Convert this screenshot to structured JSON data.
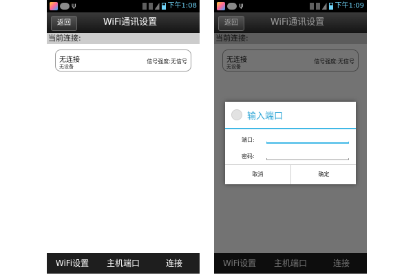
{
  "status_bar": {
    "time": "下午1:08",
    "time_right": "下午1:09"
  },
  "header": {
    "back_label": "返回",
    "title": "WiFi通讯设置"
  },
  "section": {
    "current_connection": "当前连接:"
  },
  "connection": {
    "name": "无连接",
    "device": "无设备",
    "signal": "信号强度:无信号"
  },
  "tabs": [
    {
      "label": "WiFi设置"
    },
    {
      "label": "主机端口"
    },
    {
      "label": "连接"
    }
  ],
  "dialog": {
    "title": "输入端口",
    "port_label": "端口:",
    "password_label": "密码:",
    "cancel_label": "取消",
    "confirm_label": "确定"
  },
  "colors": {
    "accent": "#3fb8e6",
    "dialog_title": "#2ea6d6",
    "overlay": "#000000"
  }
}
